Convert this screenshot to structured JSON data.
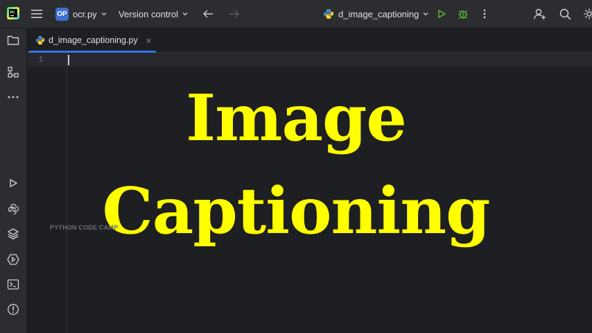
{
  "topbar": {
    "project_badge": "OP",
    "project_name": "ocr.py",
    "vcs_label": "Version control",
    "run_config": "d_image_captioning"
  },
  "tabs": [
    {
      "label": "d_image_captioning.py"
    }
  ],
  "editor": {
    "line_numbers": [
      "1"
    ]
  },
  "overlay": {
    "line1": "Image",
    "line2": "Captioning"
  },
  "watermark": "PYTHON CODE CAMP",
  "colors": {
    "accent": "#3574f0",
    "title_yellow": "#ffff00",
    "run_green": "#5fb832",
    "bg": "#1e1f22",
    "panel": "#2b2d30"
  },
  "icons": [
    "pycharm-logo-icon",
    "main-menu-icon",
    "chevron-down-icon",
    "back-arrow-icon",
    "forward-arrow-icon",
    "python-file-icon",
    "run-icon",
    "debug-icon",
    "more-vertical-icon",
    "add-user-icon",
    "search-icon",
    "settings-icon",
    "project-folder-icon",
    "structure-icon",
    "more-horizontal-icon",
    "services-run-icon",
    "python-console-icon",
    "layers-icon",
    "services-icon",
    "terminal-icon",
    "problems-icon",
    "close-icon"
  ]
}
